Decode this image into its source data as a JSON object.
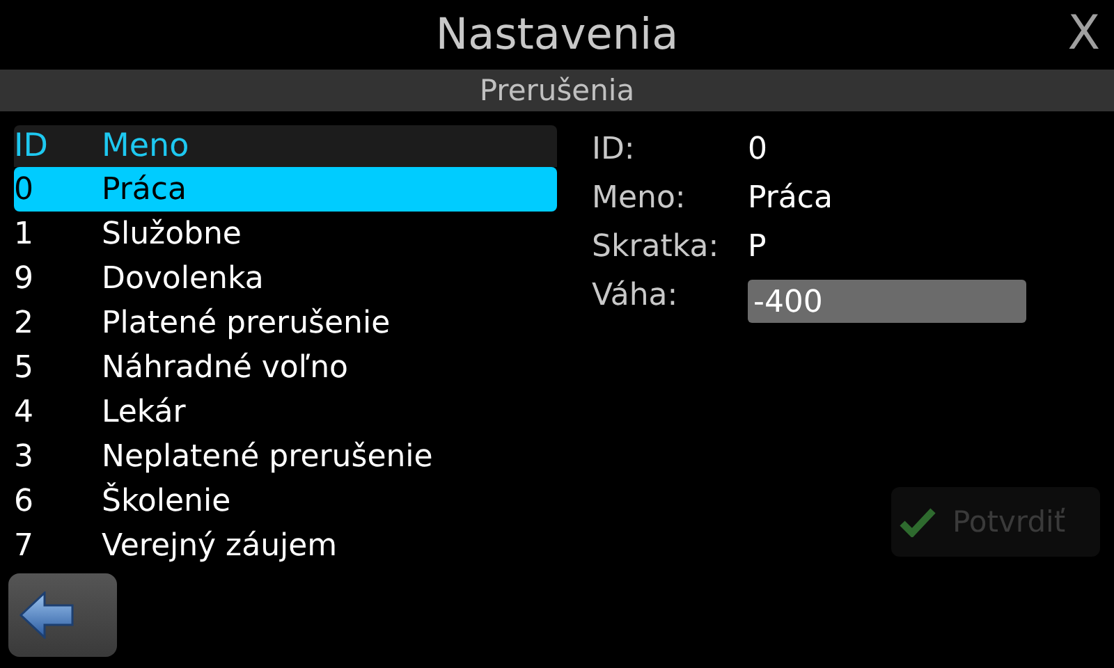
{
  "window": {
    "title": "Nastavenia",
    "close": "X"
  },
  "section": "Prerušenia",
  "table": {
    "columns": [
      "ID",
      "Meno"
    ],
    "rows": [
      {
        "id": "0",
        "name": "Práca",
        "selected": true
      },
      {
        "id": "1",
        "name": "Služobne",
        "selected": false
      },
      {
        "id": "9",
        "name": "Dovolenka",
        "selected": false
      },
      {
        "id": "2",
        "name": "Platené prerušenie",
        "selected": false
      },
      {
        "id": "5",
        "name": "Náhradné voľno",
        "selected": false
      },
      {
        "id": "4",
        "name": "Lekár",
        "selected": false
      },
      {
        "id": "3",
        "name": "Neplatené prerušenie",
        "selected": false
      },
      {
        "id": "6",
        "name": "Školenie",
        "selected": false
      },
      {
        "id": "7",
        "name": "Verejný záujem",
        "selected": false
      }
    ]
  },
  "details": [
    {
      "label": "ID:",
      "value": "0",
      "kind": "text"
    },
    {
      "label": "Meno:",
      "value": "Práca",
      "kind": "text"
    },
    {
      "label": "Skratka:",
      "value": "P",
      "kind": "text"
    },
    {
      "label": "Váha:",
      "value": "-400",
      "kind": "input"
    }
  ],
  "confirm": {
    "label": "Potvrdiť",
    "disabled": true
  }
}
